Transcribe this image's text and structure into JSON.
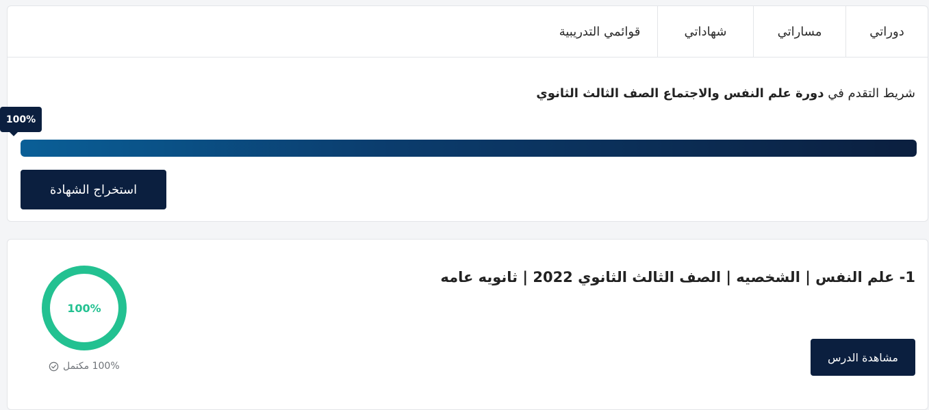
{
  "tabs": [
    {
      "label": "دوراتي"
    },
    {
      "label": "مساراتي"
    },
    {
      "label": "شهاداتي"
    },
    {
      "label": "قوائمي التدريبية"
    }
  ],
  "progress": {
    "prefix": "شريط التقدم في",
    "course_name": "دورة علم النفس والاجتماع الصف الثالث الثانوي",
    "percent_label": "100%",
    "percent": 100,
    "certificate_button": "استخراج الشهادة"
  },
  "lesson": {
    "title": "1- علم النفس | الشخصيه | الصف الثالث الثانوي 2022 | ثانويه عامه",
    "percent_label": "100%",
    "percent": 100,
    "completed_text": "100% مكتمل",
    "watch_button": "مشاهدة الدرس"
  },
  "colors": {
    "primary": "#0b1f3f",
    "accent_green": "#23c191",
    "gradient_start": "#0a5f97"
  },
  "icons": {
    "completed": "check-circle-icon"
  }
}
